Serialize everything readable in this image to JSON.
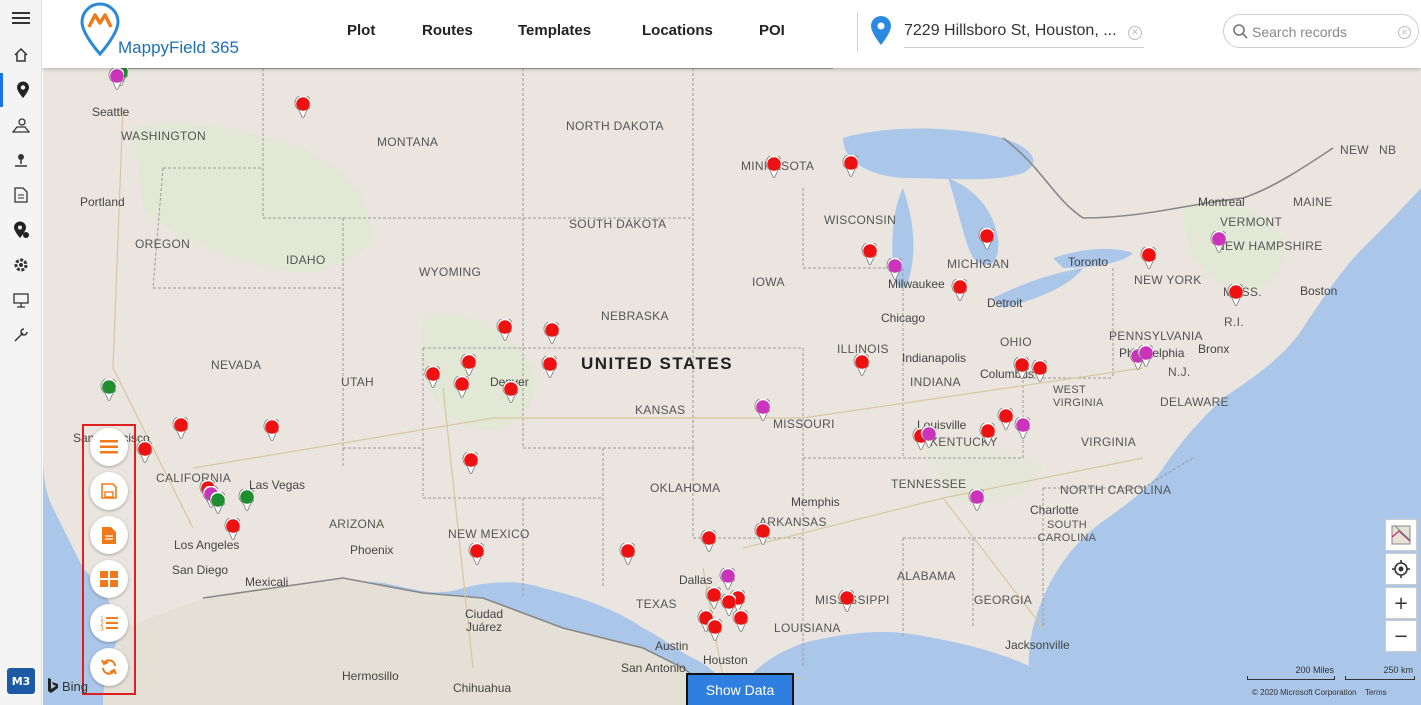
{
  "app": {
    "logo_text": "MappyField 365"
  },
  "nav": [
    "Plot",
    "Routes",
    "Templates",
    "Locations",
    "POI"
  ],
  "address": {
    "value": "7229 Hillsboro St, Houston, ..."
  },
  "search": {
    "placeholder": "Search records"
  },
  "user": {
    "initials": "M3"
  },
  "map": {
    "country": "UNITED STATES",
    "states": [
      "WASHINGTON",
      "MONTANA",
      "NORTH DAKOTA",
      "MINNESOTA",
      "OREGON",
      "IDAHO",
      "SOUTH DAKOTA",
      "WISCONSIN",
      "WYOMING",
      "MICHIGAN",
      "NEW YORK",
      "IOWA",
      "NEBRASKA",
      "ILLINOIS",
      "PENNSYLVANIA",
      "NEVADA",
      "UTAH",
      "INDIANA",
      "OHIO",
      "KANSAS",
      "MISSOURI",
      "WEST VIRGINIA",
      "KENTUCKY",
      "VIRGINIA",
      "CALIFORNIA",
      "TENNESSEE",
      "OKLAHOMA",
      "NORTH CAROLINA",
      "ARIZONA",
      "NEW MEXICO",
      "ARKANSAS",
      "SOUTH CAROLINA",
      "MISSISSIPPI",
      "ALABAMA",
      "GEORGIA",
      "TEXAS",
      "LOUISIANA",
      "VERMONT",
      "NEW HAMPSHIRE",
      "MAINE",
      "MASS.",
      "R.I.",
      "DELAWARE",
      "N.J.",
      "NEW",
      "NB"
    ],
    "cities": [
      "Seattle",
      "Portland",
      "San Francisco",
      "Las Vegas",
      "Los Angeles",
      "San Diego",
      "Mexicali",
      "Phoenix",
      "Denver",
      "Ciudad Juárez",
      "Chihuahua",
      "Hermosillo",
      "Dallas",
      "Austin",
      "San Antonio",
      "Houston",
      "Memphis",
      "Chicago",
      "Milwaukee",
      "Indianapolis",
      "Columbus",
      "Louisville",
      "Detroit",
      "Toronto",
      "Montreal",
      "Boston",
      "Bronx",
      "Philadelphia",
      "Charlotte",
      "Jacksonville"
    ],
    "show_data": "Show Data",
    "bing": "Bing",
    "scale_miles": "200 Miles",
    "scale_km": "250 km",
    "copyright": "© 2020 Microsoft Corporation",
    "terms": "Terms"
  },
  "colors": {
    "pin_red": "#ee1111",
    "pin_magenta": "#cc33bb",
    "pin_green": "#1e8e2e",
    "accent": "#1d6fb7",
    "toolbox_border": "#e02020",
    "tool_icon": "#f07a1a"
  },
  "icons": {
    "rail": [
      "hamburger-icon",
      "home-icon",
      "location-pin-icon",
      "route-map-icon",
      "territory-icon",
      "document-icon",
      "location-settings-icon",
      "gear-icon",
      "presentation-icon",
      "tools-icon"
    ],
    "tools": [
      "list-icon",
      "save-icon",
      "report-icon",
      "grid-icon",
      "numbered-list-icon",
      "refresh-icon"
    ],
    "map_controls": [
      "map-style-icon",
      "locate-icon",
      "zoom-in-icon",
      "zoom-out-icon"
    ]
  }
}
